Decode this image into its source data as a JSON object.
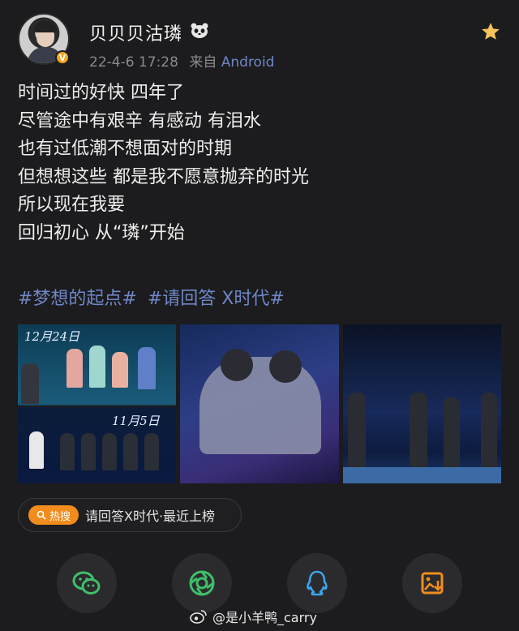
{
  "post": {
    "username": "贝贝贝沽璘",
    "time": "22-4-6 17:28",
    "source_prefix": "来自",
    "source": "Android",
    "lines": [
      "时间过的好快 四年了",
      "尽管途中有艰辛 有感动 有泪水",
      "也有过低潮不想面对的时期",
      "但想想这些 都是我不愿意抛弃的时光",
      "所以现在我要",
      "回归初心 从“璘”开始"
    ],
    "tags": [
      "#梦想的起点#",
      "#请回答 X时代#"
    ]
  },
  "images": {
    "img1_top_caption": "12月24日",
    "img1_bottom_caption": "11月5日"
  },
  "hot_search": {
    "badge": "热搜",
    "text": "请回答X时代·最近上榜"
  },
  "share": [
    "wechat-icon",
    "moments-icon",
    "qq-icon",
    "save-image-icon"
  ],
  "watermark": "@是小羊鸭_carry",
  "colors": {
    "background": "#1c1c1e",
    "link": "#6f86c6",
    "accent": "#f28c1c",
    "star": "#f6c35b"
  }
}
